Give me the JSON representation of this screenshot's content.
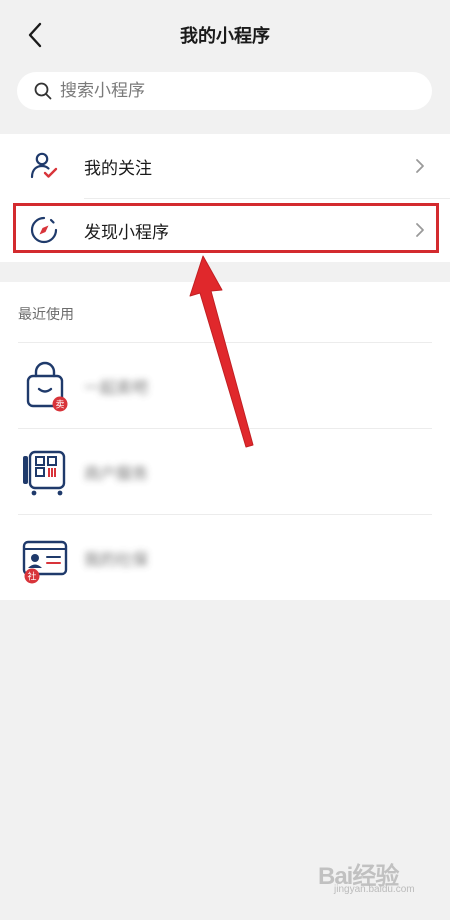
{
  "header": {
    "title": "我的小程序",
    "back_icon": "back-arrow-icon"
  },
  "search": {
    "placeholder": "搜索小程序",
    "value": "",
    "icon": "search-icon"
  },
  "menu": {
    "items": [
      {
        "label": "我的关注",
        "icon": "user-check-icon"
      },
      {
        "label": "发现小程序",
        "icon": "compass-icon"
      }
    ]
  },
  "recent": {
    "title": "最近使用",
    "items": [
      {
        "label": "一起卖吧",
        "icon": "shopping-bag-icon",
        "badge": "卖"
      },
      {
        "label": "商户服务",
        "icon": "pos-terminal-icon"
      },
      {
        "label": "我的社保",
        "icon": "id-card-icon",
        "badge": "社"
      }
    ]
  },
  "annotation": {
    "highlight_color": "#d32a2e",
    "arrow_color": "#e0282c"
  },
  "watermark": {
    "text": "Bai经验",
    "sub": "jingyan.baidu.com"
  },
  "colors": {
    "background": "#f1f1f1",
    "icon_navy": "#1f3a6b",
    "icon_red": "#d8343a",
    "accent_red": "#d32a2e"
  }
}
